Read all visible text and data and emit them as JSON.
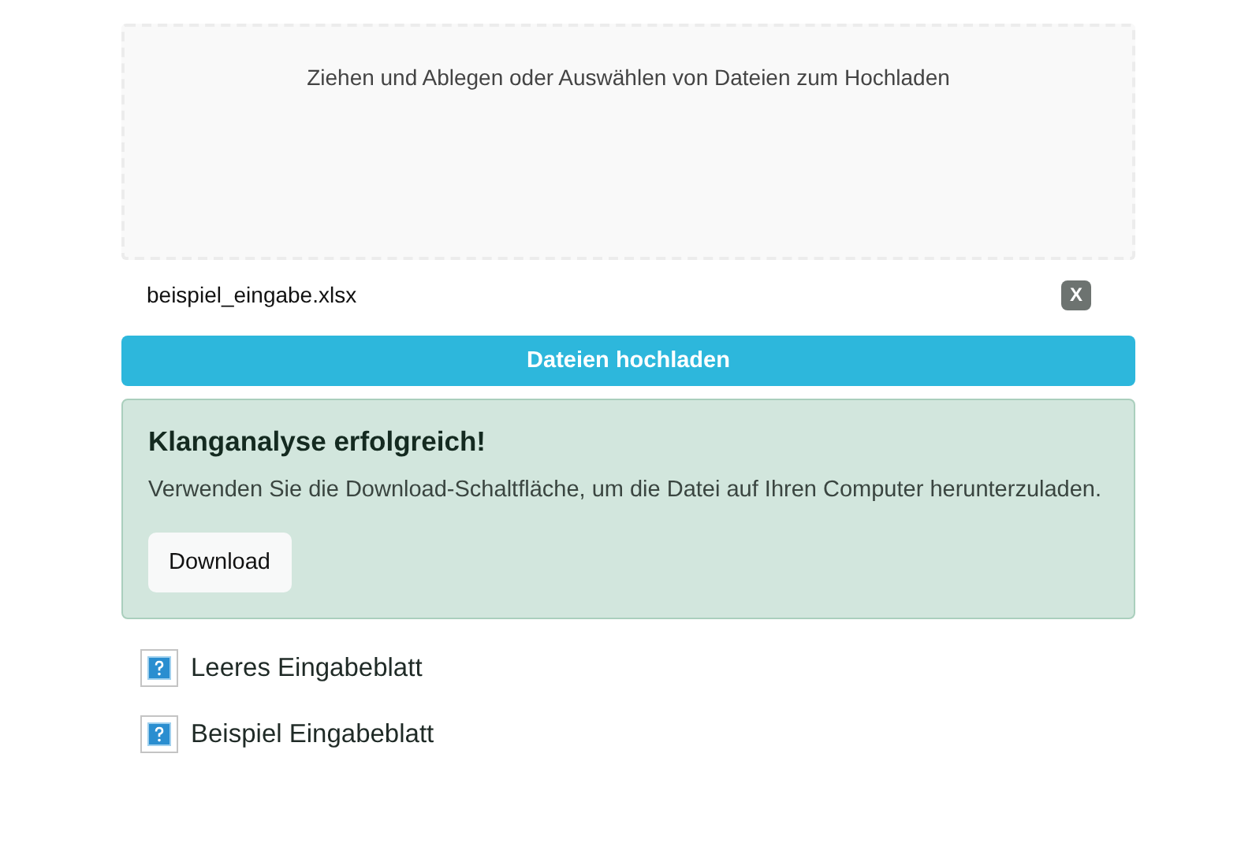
{
  "dropzone": {
    "hint": "Ziehen und Ablegen oder Auswählen von Dateien zum Hochladen"
  },
  "files": [
    {
      "name": "beispiel_eingabe.xlsx",
      "remove": "X"
    }
  ],
  "upload_button": "Dateien hochladen",
  "alert": {
    "title": "Klanganalyse erfolgreich!",
    "message": "Verwenden Sie die Download-Schaltfläche, um die Datei auf Ihren Computer herunterzuladen.",
    "button": "Download"
  },
  "links": [
    {
      "label": "Leeres Eingabeblatt"
    },
    {
      "label": "Beispiel Eingabeblatt"
    }
  ]
}
